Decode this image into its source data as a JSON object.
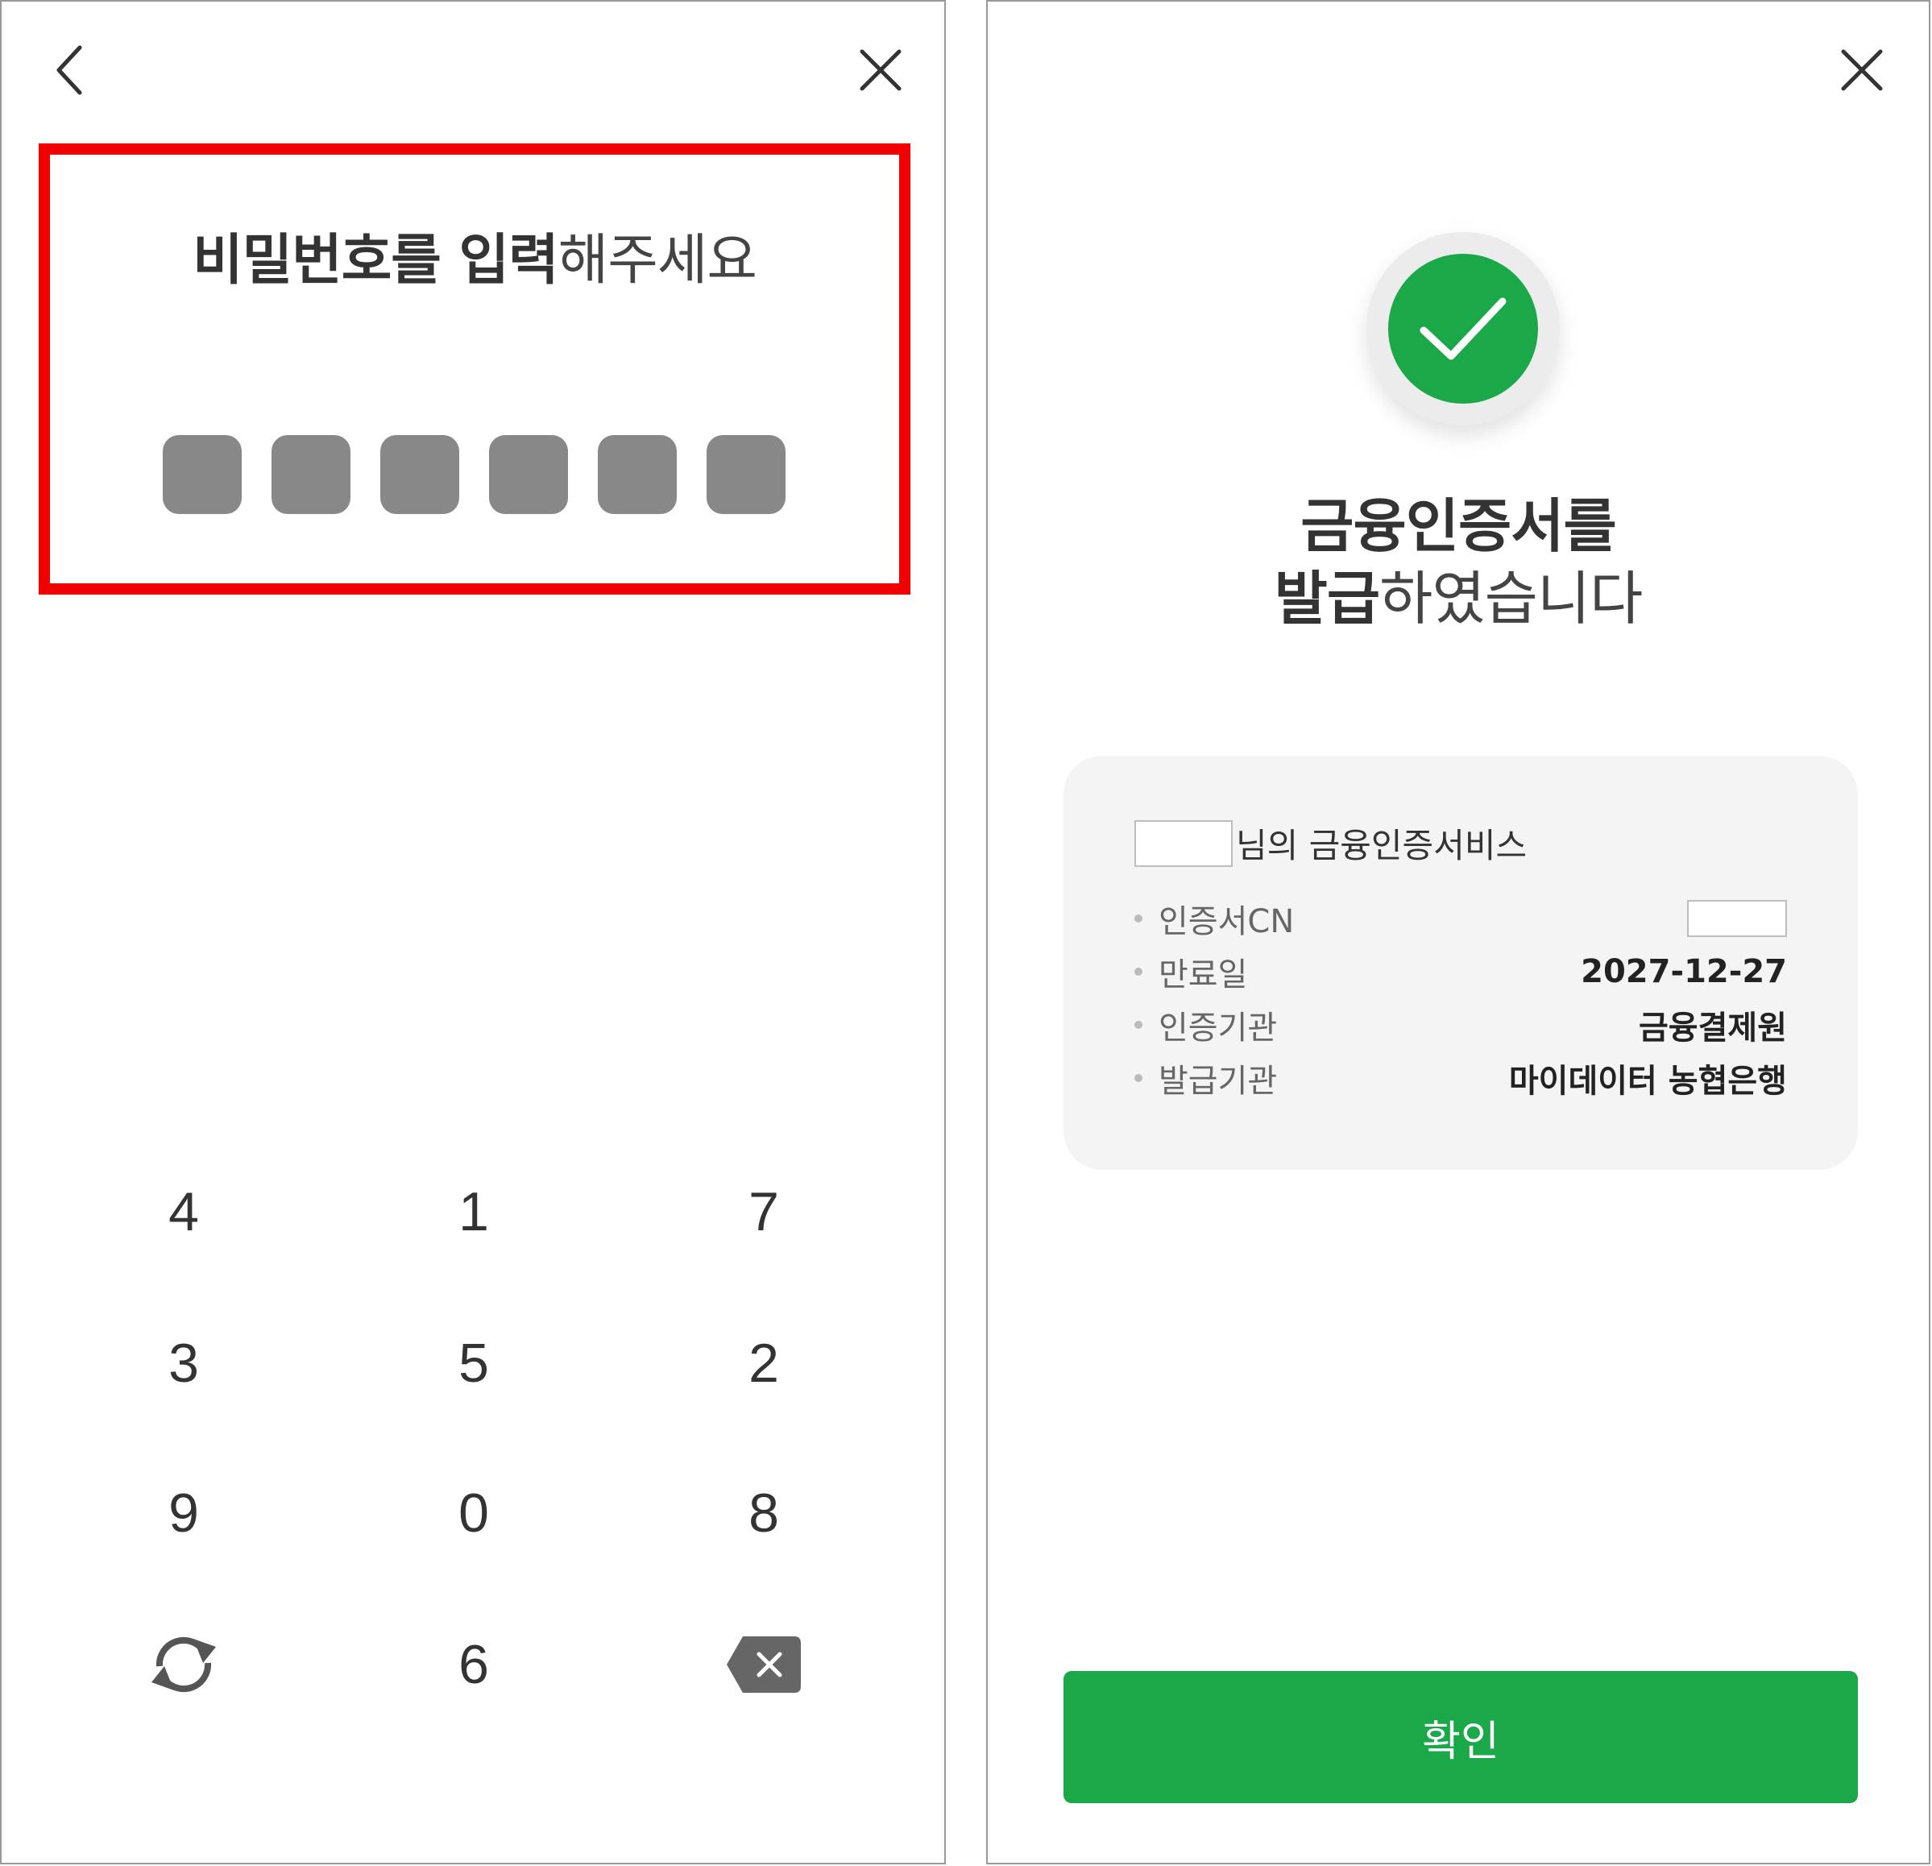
{
  "left_screen": {
    "title_bold": "비밀번호를 입력",
    "title_light": "해주세요",
    "pin_count": 6,
    "keypad": {
      "keys": [
        "4",
        "1",
        "7",
        "3",
        "5",
        "2",
        "9",
        "0",
        "8",
        "6"
      ],
      "refresh_icon": "refresh-icon",
      "backspace_icon": "backspace-icon"
    },
    "back_icon": "chevron-left-icon",
    "close_icon": "close-icon",
    "highlight_color": "#f00000"
  },
  "right_screen": {
    "title_line1": "금융인증서를",
    "title_line2_bold": "발급",
    "title_line2_light": "하였습니다",
    "service_suffix": "님의 금융인증서비스",
    "rows": [
      {
        "label": "인증서CN",
        "value": ""
      },
      {
        "label": "만료일",
        "value": "2027-12-27"
      },
      {
        "label": "인증기관",
        "value": "금융결제원"
      },
      {
        "label": "발급기관",
        "value": "마이데이터 농협은행"
      }
    ],
    "confirm_label": "확인",
    "accent_color": "#1aa848",
    "check_icon": "check-icon",
    "close_icon": "close-icon"
  }
}
